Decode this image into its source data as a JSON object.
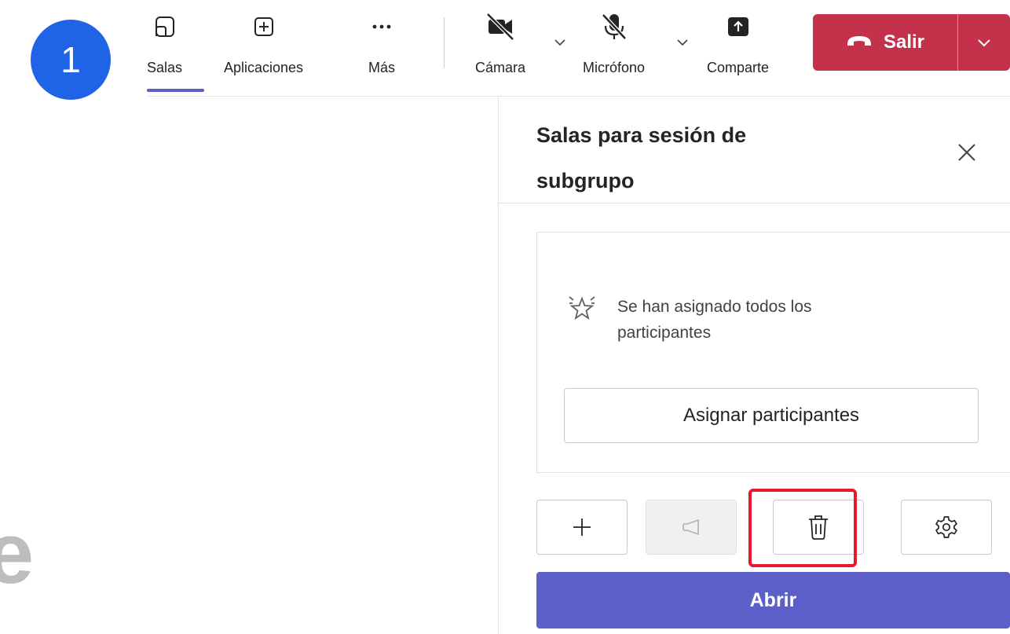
{
  "annotation": {
    "step_number": "1",
    "stray_letter": "e"
  },
  "toolbar": {
    "rooms_label": "Salas",
    "apps_label": "Aplicaciones",
    "more_label": "Más",
    "camera_label": "Cámara",
    "mic_label": "Micrófono",
    "share_label": "Comparte",
    "leave_label": "Salir"
  },
  "panel": {
    "title_line1": "Salas para sesión de",
    "title_line2": "subgrupo",
    "empty_message": "Se han asignado todos los participantes",
    "assign_button": "Asignar participantes",
    "open_button": "Abrir"
  },
  "colors": {
    "badge": "#1f63e6",
    "leave": "#c4314b",
    "primary": "#5b5fc7",
    "highlight": "#e8192c"
  },
  "icons": [
    "rooms-icon",
    "apps-icon",
    "more-icon",
    "camera-off-icon",
    "mic-off-icon",
    "share-icon",
    "phone-hangup-icon",
    "chevron-down-icon",
    "close-icon",
    "sparkle-icon",
    "add-icon",
    "announce-icon",
    "trash-icon",
    "gear-icon"
  ]
}
